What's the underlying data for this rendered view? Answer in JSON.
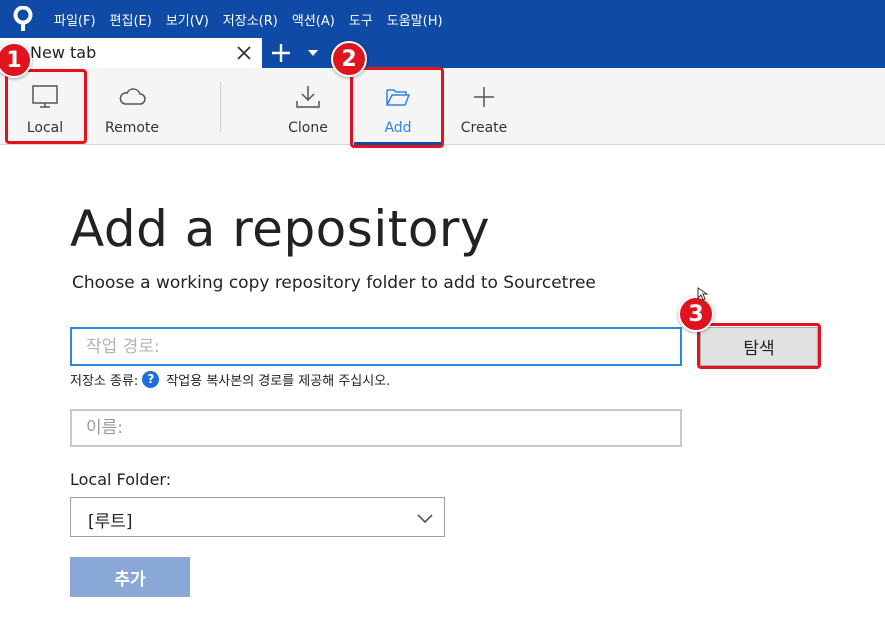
{
  "menubar": {
    "logo_icon": "sourcetree-logo-icon",
    "items": [
      "파일(F)",
      "편집(E)",
      "보기(V)",
      "저장소(R)",
      "액션(A)",
      "도구",
      "도움말(H)"
    ]
  },
  "tabs": {
    "active_tab_label": "New tab",
    "close_icon": "close-icon",
    "new_tab_icon": "plus-icon",
    "dropdown_icon": "chevron-down-icon"
  },
  "toolbar": {
    "local_label": "Local",
    "remote_label": "Remote",
    "clone_label": "Clone",
    "add_label": "Add",
    "create_label": "Create"
  },
  "badges": [
    "1",
    "2",
    "3"
  ],
  "main": {
    "title": "Add a repository",
    "subtitle": "Choose a working copy repository folder to add to Sourcetree",
    "path_placeholder": "작업 경로:",
    "browse_label": "탐색",
    "repo_type_label": "저장소 종류:",
    "repo_type_help": "?",
    "repo_type_hint": "작업용 복사본의 경로를 제공해 주십시오.",
    "name_placeholder": "이름:",
    "local_folder_label": "Local Folder:",
    "local_folder_value": "[루트]",
    "add_button_label": "추가"
  },
  "colors": {
    "menubar_bg": "#0e4aa6",
    "accent": "#2e86de",
    "highlight": "#e0141e",
    "add_button_bg": "#8aa8d6"
  }
}
